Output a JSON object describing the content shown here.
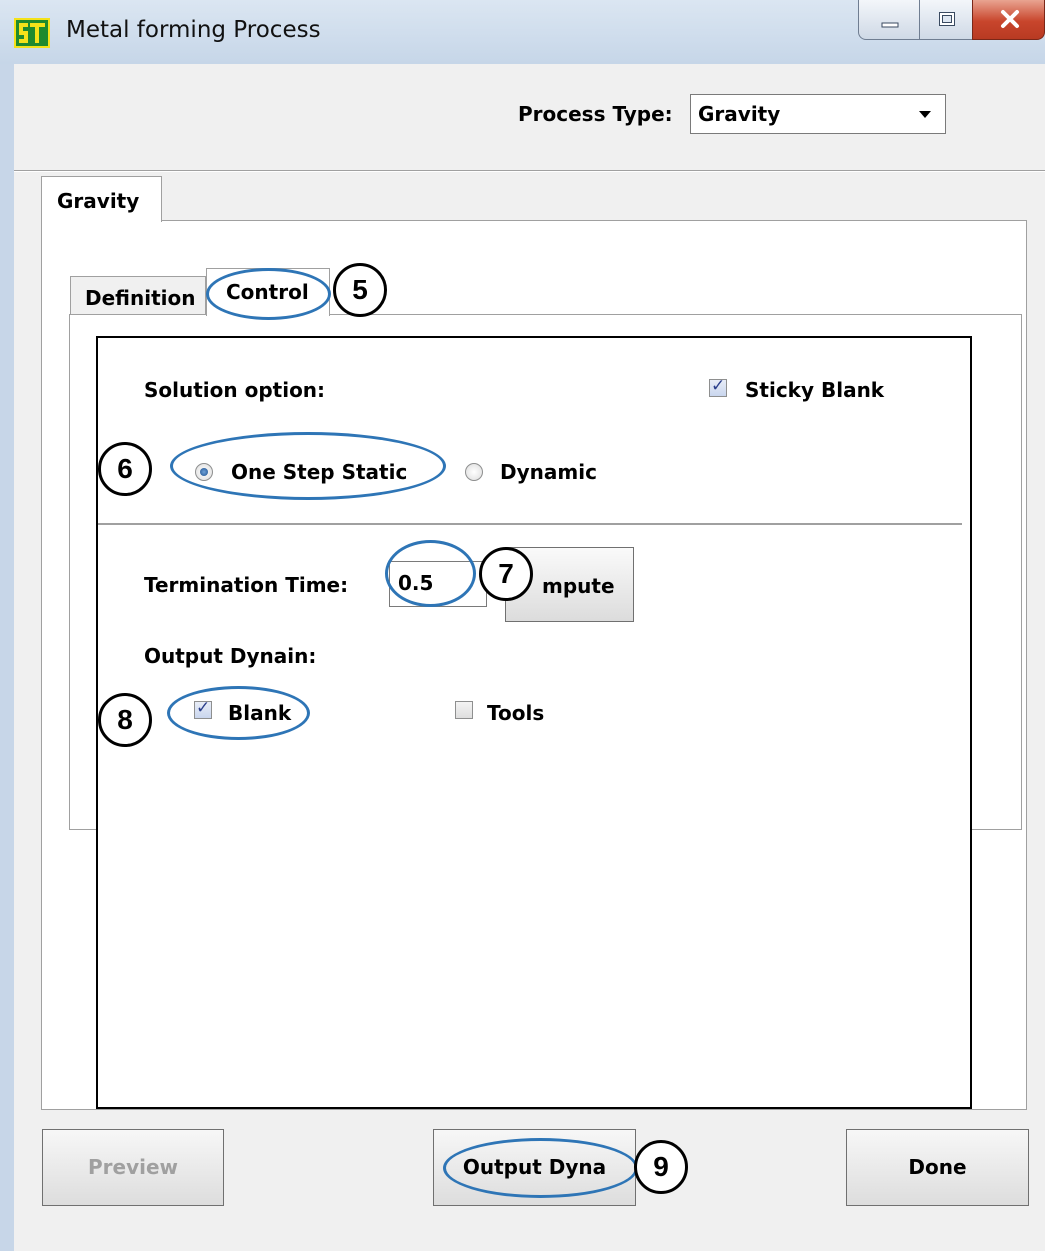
{
  "window": {
    "title": "Metal forming Process",
    "app_icon": "stf-logo-icon",
    "controls": [
      "minimize-icon",
      "maximize-icon",
      "close-icon"
    ]
  },
  "header": {
    "process_type_label": "Process Type:",
    "process_type_value": "Gravity"
  },
  "outer_tabs": [
    {
      "label": "Gravity",
      "selected": true
    }
  ],
  "inner_tabs": [
    {
      "label": "Definition",
      "selected": false
    },
    {
      "label": "Control",
      "selected": true
    }
  ],
  "control": {
    "solution_option_label": "Solution option:",
    "sticky_blank": {
      "label": "Sticky Blank",
      "checked": true
    },
    "solution_options": [
      {
        "label": "One Step Static",
        "selected": true
      },
      {
        "label": "Dynamic",
        "selected": false
      }
    ],
    "termination_time_label": "Termination Time:",
    "termination_time_value": "0.5",
    "compute_button_label": "mpute",
    "output_dynain_label": "Output Dynain:",
    "blank": {
      "label": "Blank",
      "checked": true
    },
    "tools": {
      "label": "Tools",
      "checked": false
    }
  },
  "footer": {
    "preview_label": "Preview",
    "preview_enabled": false,
    "output_dyna_label": "Output Dyna",
    "done_label": "Done"
  },
  "annotations": {
    "callout_5": "5",
    "callout_6": "6",
    "callout_7": "7",
    "callout_8": "8",
    "callout_9": "9",
    "highlight_color": "#2e75b6"
  }
}
